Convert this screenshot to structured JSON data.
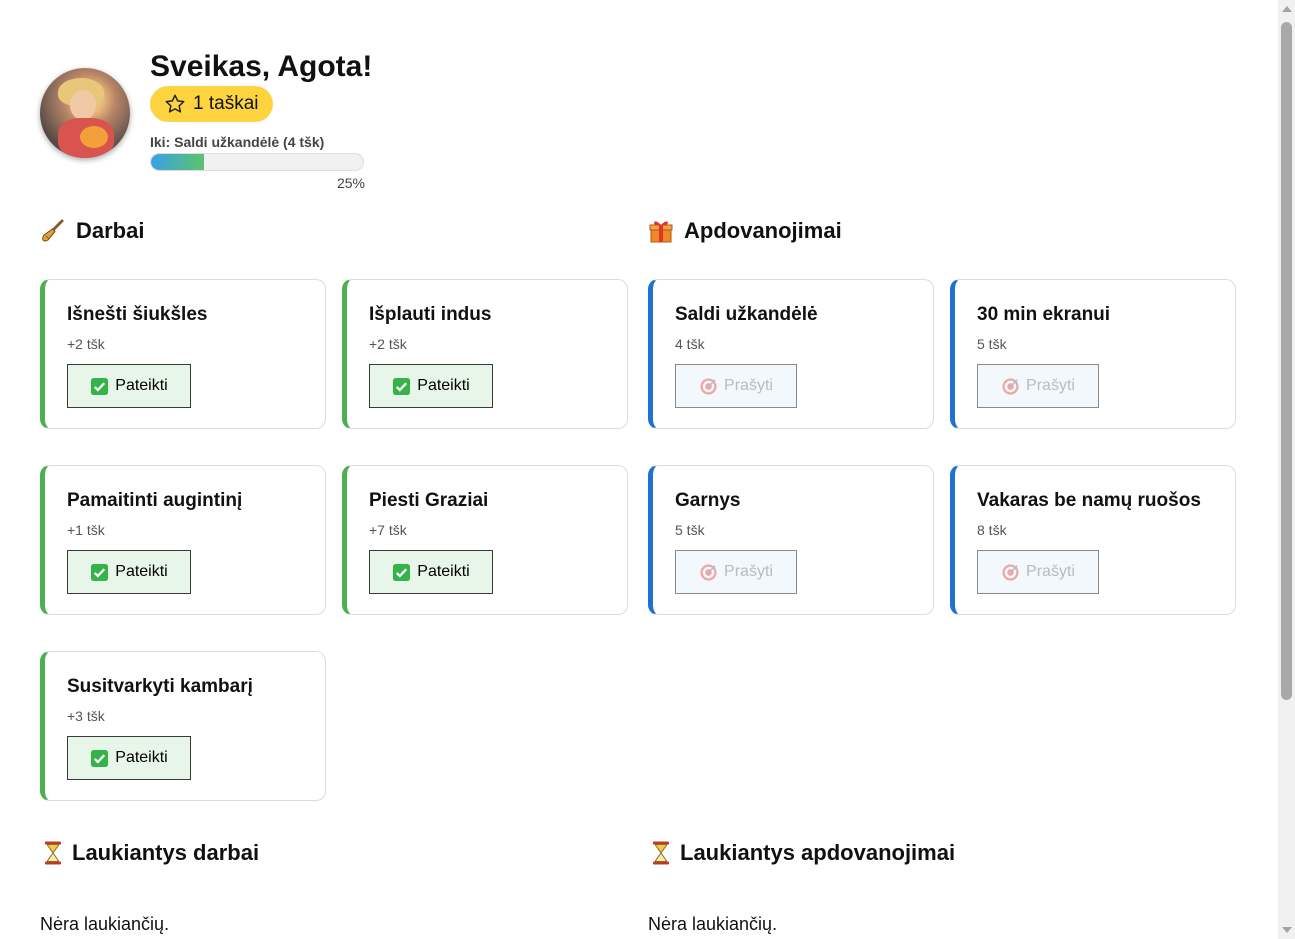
{
  "header": {
    "greeting": "Sveikas, Agota!",
    "points_label": "1 taškai",
    "goal_label": "Iki: Saldi užkandėlė (4 tšk)",
    "progress": 0.25,
    "progress_label": "25%"
  },
  "chores": {
    "title": "Darbai",
    "icon": "broom-icon",
    "items": [
      {
        "name": "Išnešti šiukšles",
        "points": "+2 tšk",
        "button": "Pateikti"
      },
      {
        "name": "Išplauti indus",
        "points": "+2 tšk",
        "button": "Pateikti"
      },
      {
        "name": "Pamaitinti augintinį",
        "points": "+1 tšk",
        "button": "Pateikti"
      },
      {
        "name": "Piesti Graziai",
        "points": "+7 tšk",
        "button": "Pateikti"
      },
      {
        "name": "Susitvarkyti kambarį",
        "points": "+3 tšk",
        "button": "Pateikti"
      }
    ]
  },
  "rewards": {
    "title": "Apdovanojimai",
    "icon": "gift-icon",
    "items": [
      {
        "name": "Saldi užkandėlė",
        "points": "4 tšk",
        "button": "Prašyti"
      },
      {
        "name": "30 min ekranui",
        "points": "5 tšk",
        "button": "Prašyti"
      },
      {
        "name": "Garnys",
        "points": "5 tšk",
        "button": "Prašyti"
      },
      {
        "name": "Vakaras be namų ruošos",
        "points": "8 tšk",
        "button": "Prašyti"
      }
    ]
  },
  "pending_chores": {
    "title": "Laukiantys darbai",
    "icon": "hourglass-icon",
    "empty": "Nėra laukiančių."
  },
  "pending_rewards": {
    "title": "Laukiantys apdovanojimai",
    "icon": "hourglass-icon",
    "empty": "Nėra laukiančių."
  },
  "colors": {
    "chore_accent": "#4caf50",
    "reward_accent": "#1e73d2",
    "points_badge": "#fdd33f"
  }
}
